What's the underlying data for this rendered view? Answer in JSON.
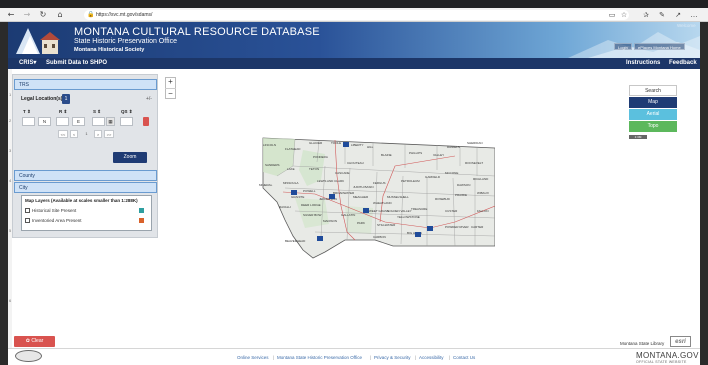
{
  "browser": {
    "url": "https://svc.mt.gov/sdams/",
    "icons": [
      "back-icon",
      "forward-icon",
      "refresh-icon",
      "home-icon",
      "lock-icon",
      "reader-icon",
      "favorite-icon",
      "favorites-icon",
      "collections-icon",
      "share-icon",
      "more-icon"
    ]
  },
  "header": {
    "title": "MONTANA CULTURAL RESOURCE DATABASE",
    "subtitle": "State Historic Preservation Office",
    "org": "Montana Historical Society",
    "welcome": "Welcome",
    "login": "Login",
    "eplaces": "ePlaces Montana Home"
  },
  "menu": {
    "cris": "CRIS",
    "submit": "Submit Data to SHPO",
    "instructions": "Instructions",
    "feedback": "Feedback"
  },
  "gutter_numbers": [
    "1",
    "2",
    "3",
    "4",
    "5",
    "6"
  ],
  "search_panel": {
    "trs_label": "TRS",
    "legal_location": "Legal Location(s)",
    "legal_btn": "1",
    "plus_minus": "+/-",
    "columns": [
      "T",
      "R",
      "S",
      "QS"
    ],
    "fields": {
      "t_value": "",
      "t_dir": "N",
      "r_value": "",
      "r_dir": "E",
      "s_value": "",
      "qs_value": ""
    },
    "pager": {
      "first": "<<",
      "prev": "<",
      "page": "1",
      "next": ">",
      "last": ">>"
    },
    "zoom": "Zoom",
    "county": "County",
    "city": "City"
  },
  "map_layers": {
    "title": "Map Layers (Available at scales smaller than 1:288K)",
    "items": [
      {
        "label": "Historical Site Present",
        "color": "#2e9fa0"
      },
      {
        "label": "Inventoried Area Present",
        "color": "#d9622b"
      }
    ]
  },
  "map": {
    "zoom_in": "+",
    "zoom_out": "−",
    "basemaps": {
      "search": "Search",
      "map": "Map",
      "aerial": "Aerial",
      "topo": "Topo"
    },
    "scale": "1:3M",
    "counties": [
      "LINCOLN",
      "FLATHEAD",
      "GLACIER",
      "TOOLE",
      "LIBERTY",
      "HILL",
      "BLAINE",
      "PHILLIPS",
      "VALLEY",
      "DANIELS",
      "SHERIDAN",
      "ROOSEVELT",
      "SANDERS",
      "LAKE",
      "PONDERA",
      "TETON",
      "CHOUTEAU",
      "FERGUS",
      "PETROLEUM",
      "GARFIELD",
      "MCCONE",
      "RICHLAND",
      "DAWSON",
      "MINERAL",
      "MISSOULA",
      "POWELL",
      "LEWIS AND CLARK",
      "CASCADE",
      "JUDITH BASIN",
      "MUSSELSHELL",
      "ROSEBUD",
      "PRAIRIE",
      "WIBAUX",
      "RAVALLI",
      "GRANITE",
      "DEER LODGE",
      "JEFFERSON",
      "BROADWATER",
      "MEAGHER",
      "WHEATLAND",
      "GOLDEN VALLEY",
      "TREASURE",
      "CUSTER",
      "FALLON",
      "SILVER BOW",
      "MADISON",
      "GALLATIN",
      "PARK",
      "SWEET GRASS",
      "STILLWATER",
      "YELLOWSTONE",
      "BIG HORN",
      "POWDER RIVER",
      "CARTER",
      "BEAVERHEAD",
      "CARBON"
    ]
  },
  "clear": "Clear",
  "library": "Montana State Library",
  "esri": "esri",
  "footer": {
    "links": [
      "Online Services",
      "Montana State Historic Preservation Office",
      "Privacy & Security",
      "Accessibility",
      "Contact Us"
    ],
    "mtgov": "MONTANA.GOV",
    "mtgov_sub": "OFFICIAL STATE WEBSITE"
  },
  "colors": {
    "navy": "#1c3668",
    "map_blue": "#1f3b74",
    "aerial": "#5bc0de",
    "topo": "#5cb85c",
    "clear": "#d9534f"
  }
}
